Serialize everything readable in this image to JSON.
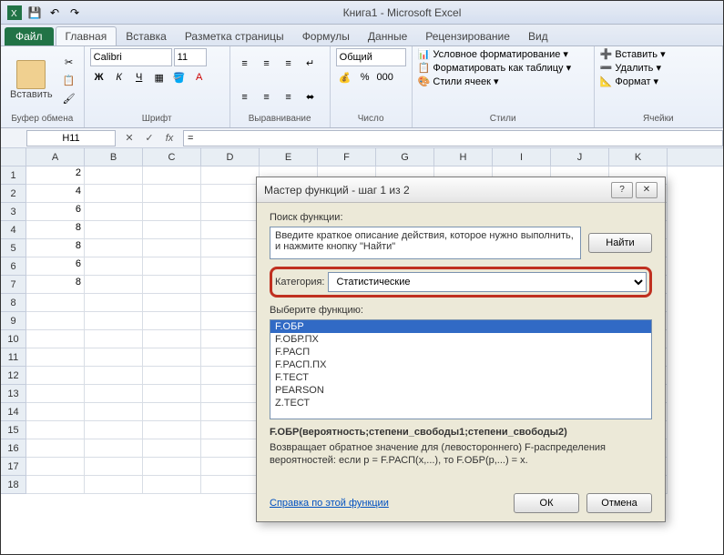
{
  "title": "Книга1 - Microsoft Excel",
  "tabs": {
    "file": "Файл",
    "items": [
      "Главная",
      "Вставка",
      "Разметка страницы",
      "Формулы",
      "Данные",
      "Рецензирование",
      "Вид"
    ],
    "active": 0
  },
  "ribbon": {
    "clipboard": {
      "label": "Буфер обмена",
      "paste": "Вставить"
    },
    "font": {
      "label": "Шрифт",
      "name": "Calibri",
      "size": "11"
    },
    "alignment": {
      "label": "Выравнивание"
    },
    "number": {
      "label": "Число",
      "format": "Общий"
    },
    "styles": {
      "label": "Стили",
      "conditional": "Условное форматирование",
      "table": "Форматировать как таблицу",
      "cell": "Стили ячеек"
    },
    "cells_group": {
      "label": "Ячейки",
      "insert": "Вставить",
      "delete": "Удалить",
      "format": "Формат"
    }
  },
  "namebox": "H11",
  "formula": "=",
  "columns": [
    "A",
    "B",
    "C",
    "D",
    "E",
    "F",
    "G",
    "H",
    "I",
    "J",
    "K"
  ],
  "rows": [
    1,
    2,
    3,
    4,
    5,
    6,
    7,
    8,
    9,
    10,
    11,
    12,
    13,
    14,
    15,
    16,
    17,
    18
  ],
  "data": {
    "A1": "2",
    "A2": "4",
    "A3": "6",
    "A4": "8",
    "A5": "8",
    "A6": "6",
    "A7": "8"
  },
  "dialog": {
    "title": "Мастер функций - шаг 1 из 2",
    "search_label": "Поиск функции:",
    "search_text": "Введите краткое описание действия, которое нужно выполнить, и нажмите кнопку \"Найти\"",
    "find": "Найти",
    "category_label": "Категория:",
    "category_value": "Статистические",
    "select_label": "Выберите функцию:",
    "functions": [
      "F.ОБР",
      "F.ОБР.ПХ",
      "F.РАСП",
      "F.РАСП.ПХ",
      "F.ТЕСТ",
      "PEARSON",
      "Z.ТЕСТ"
    ],
    "selected_fn": 0,
    "signature": "F.ОБР(вероятность;степени_свободы1;степени_свободы2)",
    "description": "Возвращает обратное значение для (левостороннего) F-распределения вероятностей: если p = F.РАСП(x,...), то F.ОБР(p,...) = x.",
    "help": "Справка по этой функции",
    "ok": "ОК",
    "cancel": "Отмена"
  }
}
